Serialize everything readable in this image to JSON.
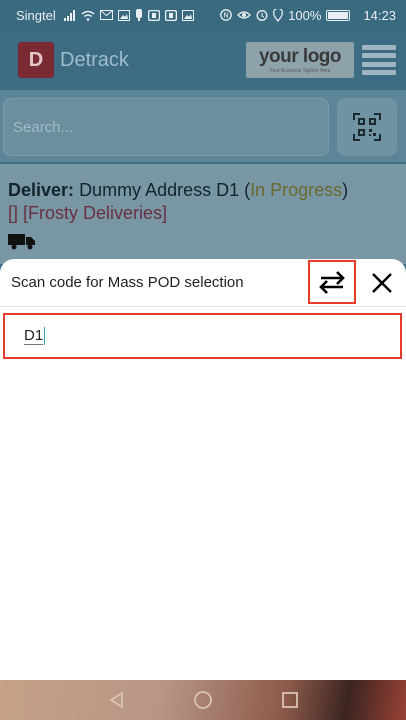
{
  "status_bar": {
    "carrier": "Singtel",
    "battery": "100%",
    "time": "14:23"
  },
  "app_bar": {
    "logo_letter": "D",
    "brand": "Detrack",
    "custom_logo": "your logo",
    "custom_logo_tagline": "Your Business Tagline Here"
  },
  "search": {
    "placeholder": "Search..."
  },
  "job": {
    "prefix": "Deliver:",
    "address": "Dummy Address D1",
    "status": "In Progress",
    "tags": "[] [Frosty Deliveries]"
  },
  "modal": {
    "title": "Scan code for Mass POD selection",
    "input_value": "D1"
  },
  "colors": {
    "highlight_border": "#e53b2a",
    "overlay_bg": "#3f6f86"
  },
  "icons": [
    "wifi-icon",
    "qr-scan-icon",
    "swap-icon",
    "close-icon",
    "truck-icon",
    "menu-icon"
  ]
}
